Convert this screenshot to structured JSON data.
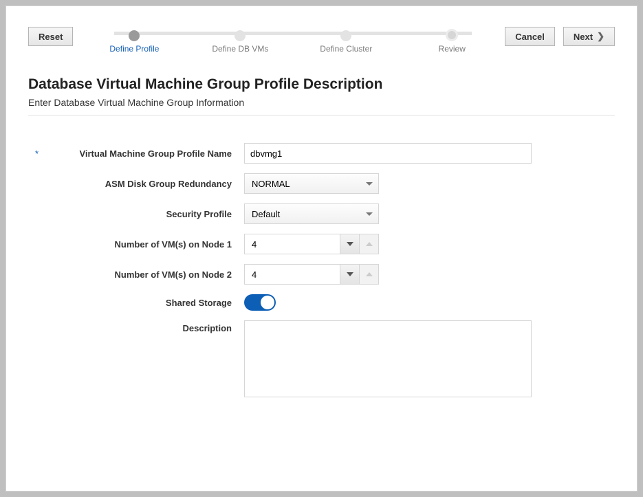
{
  "buttons": {
    "reset": "Reset",
    "cancel": "Cancel",
    "next": "Next"
  },
  "stepper": {
    "steps": [
      {
        "label": "Define Profile",
        "active": true
      },
      {
        "label": "Define DB VMs",
        "active": false
      },
      {
        "label": "Define Cluster",
        "active": false
      },
      {
        "label": "Review",
        "active": false
      }
    ]
  },
  "header": {
    "title": "Database Virtual Machine Group Profile Description",
    "subtitle": "Enter Database Virtual Machine Group Information"
  },
  "form": {
    "profile_name_label": "Virtual Machine Group Profile Name",
    "profile_name_value": "dbvmg1",
    "asm_label": "ASM Disk Group Redundancy",
    "asm_value": "NORMAL",
    "security_label": "Security Profile",
    "security_value": "Default",
    "node1_label": "Number of VM(s) on Node 1",
    "node1_value": "4",
    "node2_label": "Number of VM(s) on Node 2",
    "node2_value": "4",
    "shared_storage_label": "Shared Storage",
    "shared_storage_on": true,
    "description_label": "Description",
    "description_value": ""
  }
}
